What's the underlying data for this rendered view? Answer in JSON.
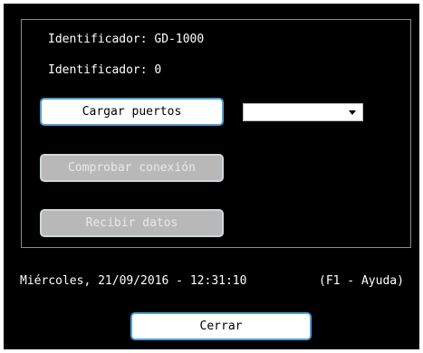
{
  "info": {
    "device_id": "Identificador: GD-1000",
    "id_value": "Identificador: 0"
  },
  "buttons": {
    "load_ports": "Cargar puertos",
    "check_connection": "Comprobar conexión",
    "receive_data": "Recibir datos",
    "close": "Cerrar"
  },
  "port_select": {
    "selected": ""
  },
  "status_bar": {
    "datetime": "Miércoles, 21/09/2016 - 12:31:10",
    "help": "(F1 - Ayuda)"
  },
  "colors": {
    "background": "#000000",
    "text": "#ffffff",
    "button_border": "#4f9fd4",
    "disabled_button": "#b8b8b8"
  }
}
